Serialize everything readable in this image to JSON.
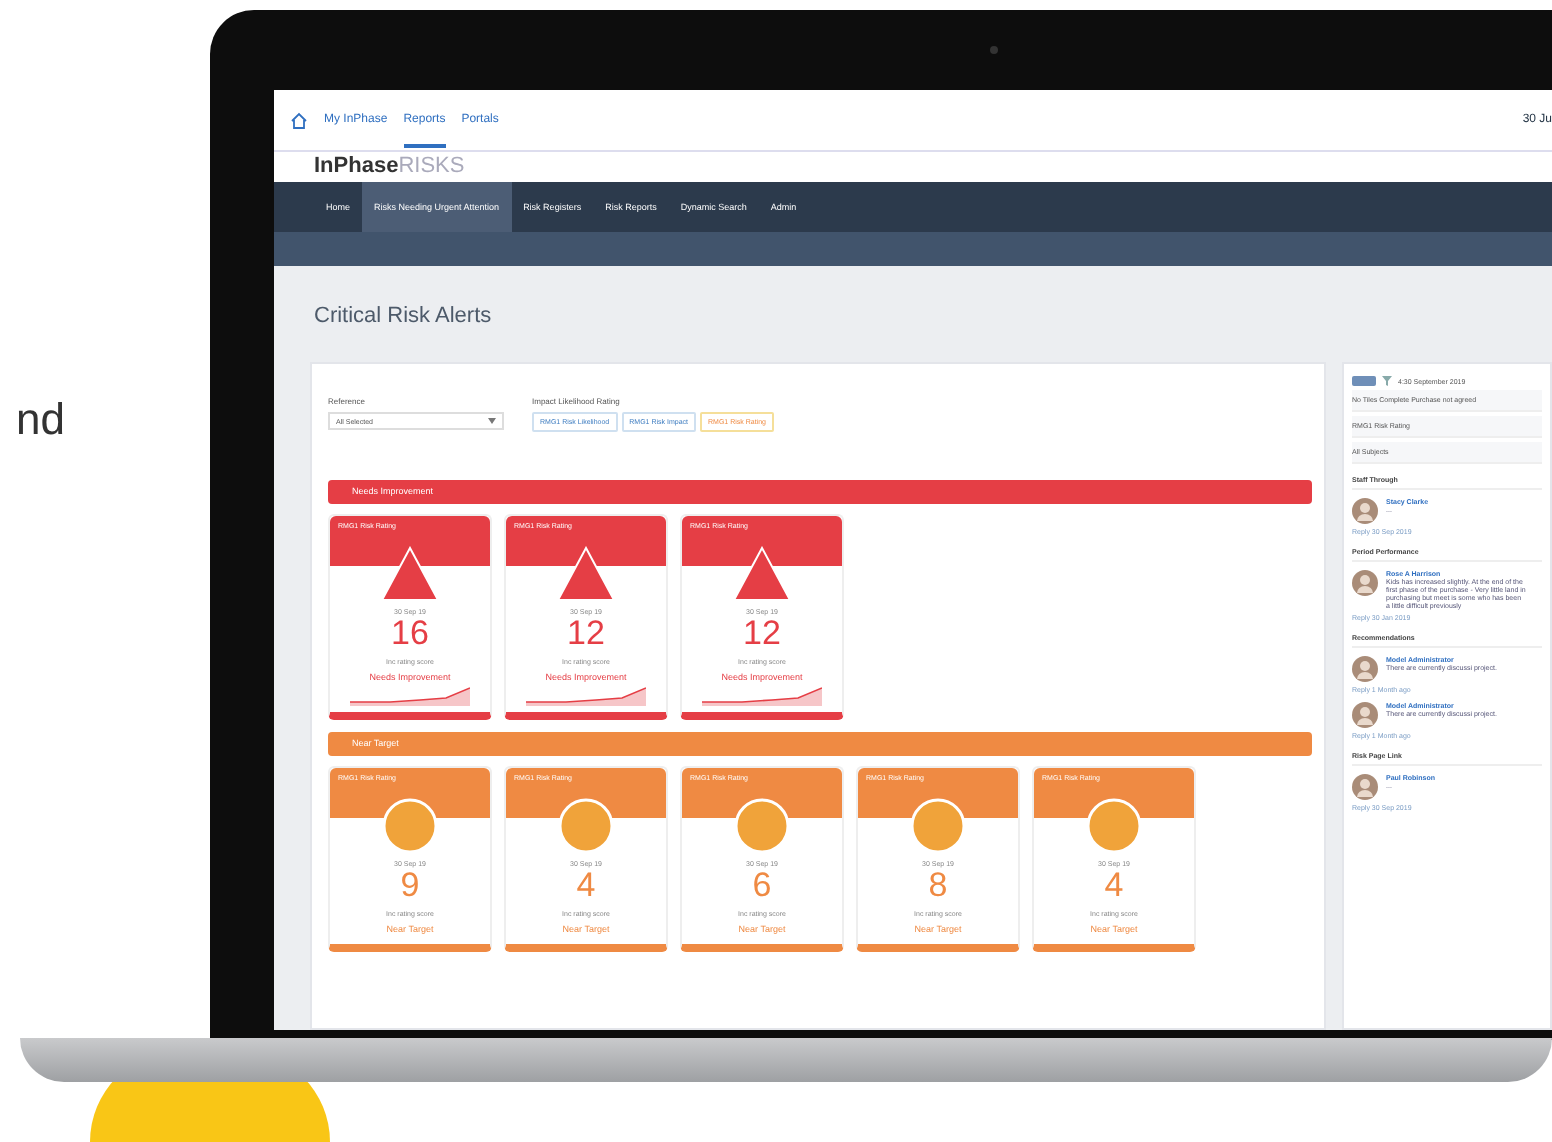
{
  "intro_text": "nd",
  "topbar": {
    "links": [
      {
        "label": "My InPhase",
        "selected": false
      },
      {
        "label": "Reports",
        "selected": true
      },
      {
        "label": "Portals",
        "selected": false
      }
    ],
    "date": "30 Ju"
  },
  "logo": {
    "brand": "InPhase",
    "product": "RISKS"
  },
  "nav": [
    {
      "label": "Home",
      "selected": false
    },
    {
      "label": "Risks Needing Urgent Attention",
      "selected": true
    },
    {
      "label": "Risk Registers",
      "selected": false
    },
    {
      "label": "Risk Reports",
      "selected": false
    },
    {
      "label": "Dynamic Search",
      "selected": false
    },
    {
      "label": "Admin",
      "selected": false
    }
  ],
  "page_title": "Critical Risk Alerts",
  "filters": {
    "reference_label": "Reference",
    "reference_value": "All Selected",
    "rating_label": "Impact Likelihood Rating",
    "chips": [
      {
        "label": "RMG1 Risk Likelihood",
        "selected": false
      },
      {
        "label": "RMG1 Risk Impact",
        "selected": false
      },
      {
        "label": "RMG1 Risk Rating",
        "selected": true
      }
    ]
  },
  "sections": [
    {
      "title": "Needs Improvement",
      "kind": "triangle",
      "color": "#e53e45",
      "cards": [
        {
          "header": "RMG1 Risk Rating",
          "date": "30 Sep 19",
          "value": "16",
          "caption": "Inc rating score",
          "status": "Needs Improvement"
        },
        {
          "header": "RMG1 Risk Rating",
          "date": "30 Sep 19",
          "value": "12",
          "caption": "Inc rating score",
          "status": "Needs Improvement"
        },
        {
          "header": "RMG1 Risk Rating",
          "date": "30 Sep 19",
          "value": "12",
          "caption": "Inc rating score",
          "status": "Needs Improvement"
        }
      ]
    },
    {
      "title": "Near Target",
      "kind": "circle",
      "color": "#ef8a43",
      "cards": [
        {
          "header": "RMG1 Risk Rating",
          "date": "30 Sep 19",
          "value": "9",
          "caption": "Inc rating score",
          "status": "Near Target"
        },
        {
          "header": "RMG1 Risk Rating",
          "date": "30 Sep 19",
          "value": "4",
          "caption": "Inc rating score",
          "status": "Near Target"
        },
        {
          "header": "RMG1 Risk Rating",
          "date": "30 Sep 19",
          "value": "6",
          "caption": "Inc rating score",
          "status": "Near Target"
        },
        {
          "header": "RMG1 Risk Rating",
          "date": "30 Sep 19",
          "value": "8",
          "caption": "Inc rating score",
          "status": "Near Target"
        },
        {
          "header": "RMG1 Risk Rating",
          "date": "30 Sep 19",
          "value": "4",
          "caption": "Inc rating score",
          "status": "Near Target"
        }
      ]
    }
  ],
  "sidebar": {
    "toggle_on": true,
    "date": "4:30 September 2019",
    "lines": [
      "No Tiles Complete Purchase not agreed",
      "RMG1 Risk Rating",
      "All Subjects"
    ],
    "groups": [
      {
        "title": "Staff Through",
        "posts": [
          {
            "author": "Stacy Clarke",
            "text": "...",
            "meta": "Reply  30 Sep 2019"
          }
        ]
      },
      {
        "title": "Period Performance",
        "posts": [
          {
            "author": "Rose A Harrison",
            "text": "Kids has increased slightly. At the end of the first phase of the purchase - Very little land in purchasing but meet is some who has been a little difficult previously",
            "meta": "Reply  30 Jan 2019"
          }
        ]
      },
      {
        "title": "Recommendations",
        "posts": [
          {
            "author": "Model Administrator",
            "text": "There are currently discussi project.",
            "meta": "Reply  1 Month ago"
          },
          {
            "author": "Model Administrator",
            "text": "There are currently discussi project.",
            "meta": "Reply  1 Month ago"
          }
        ]
      },
      {
        "title": "Risk Page Link",
        "posts": [
          {
            "author": "Paul Robinson",
            "text": "...",
            "meta": "Reply  30 Sep 2019"
          }
        ]
      }
    ]
  }
}
